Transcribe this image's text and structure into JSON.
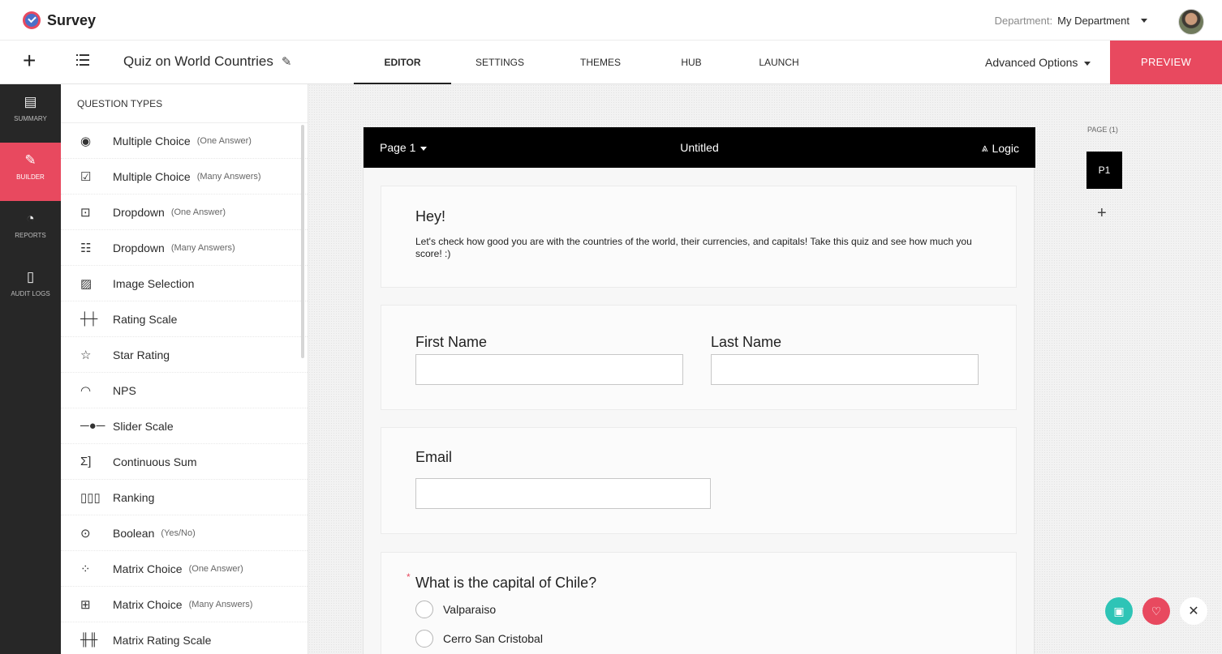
{
  "app": {
    "name": "Survey"
  },
  "header": {
    "department_label": "Department:",
    "department_value": "My Department"
  },
  "subbar": {
    "survey_title": "Quiz on World Countries",
    "tabs": [
      {
        "label": "EDITOR"
      },
      {
        "label": "SETTINGS"
      },
      {
        "label": "THEMES"
      },
      {
        "label": "HUB"
      },
      {
        "label": "LAUNCH"
      }
    ],
    "advanced_options": "Advanced Options",
    "preview_label": "PREVIEW"
  },
  "rail": {
    "items": [
      {
        "label": "SUMMARY",
        "icon": "document-icon"
      },
      {
        "label": "BUILDER",
        "icon": "pencil-icon",
        "active": true
      },
      {
        "label": "REPORTS",
        "icon": "pie-chart-icon"
      },
      {
        "label": "AUDIT LOGS",
        "icon": "log-file-icon"
      }
    ]
  },
  "question_types": {
    "title": "QUESTION TYPES",
    "items": [
      {
        "label": "Multiple Choice",
        "sub": "(One Answer)",
        "icon": "◉"
      },
      {
        "label": "Multiple Choice",
        "sub": "(Many Answers)",
        "icon": "☑"
      },
      {
        "label": "Dropdown",
        "sub": "(One Answer)",
        "icon": "⊡"
      },
      {
        "label": "Dropdown",
        "sub": "(Many Answers)",
        "icon": "☷"
      },
      {
        "label": "Image Selection",
        "sub": "",
        "icon": "▨"
      },
      {
        "label": "Rating Scale",
        "sub": "",
        "icon": "┼┼"
      },
      {
        "label": "Star Rating",
        "sub": "",
        "icon": "☆"
      },
      {
        "label": "NPS",
        "sub": "",
        "icon": "◠"
      },
      {
        "label": "Slider Scale",
        "sub": "",
        "icon": "─●─"
      },
      {
        "label": "Continuous Sum",
        "sub": "",
        "icon": "Σ]"
      },
      {
        "label": "Ranking",
        "sub": "",
        "icon": "▯▯▯"
      },
      {
        "label": "Boolean",
        "sub": "(Yes/No)",
        "icon": "⊙"
      },
      {
        "label": "Matrix Choice",
        "sub": "(One Answer)",
        "icon": "⁘"
      },
      {
        "label": "Matrix Choice",
        "sub": "(Many Answers)",
        "icon": "⊞"
      },
      {
        "label": "Matrix Rating Scale",
        "sub": "",
        "icon": "╫╫"
      }
    ]
  },
  "page": {
    "name": "Page 1",
    "title": "Untitled",
    "logic_label": "Logic"
  },
  "intro": {
    "heading": "Hey!",
    "description": "Let's check how good you are with the countries of the world, their currencies, and capitals! Take this quiz and see how much you score! :)"
  },
  "name_block": {
    "first_name_label": "First Name",
    "last_name_label": "Last Name"
  },
  "email_block": {
    "label": "Email"
  },
  "question": {
    "required_mark": "*",
    "text": "What is the capital of Chile?",
    "options": [
      "Valparaiso",
      "Cerro San Cristobal"
    ]
  },
  "page_nav": {
    "count_label": "PAGE (1)",
    "current": "P1",
    "add": "+"
  },
  "colors": {
    "accent": "#e8495f",
    "rail_bg": "#272727",
    "teal": "#2ec4b6"
  }
}
